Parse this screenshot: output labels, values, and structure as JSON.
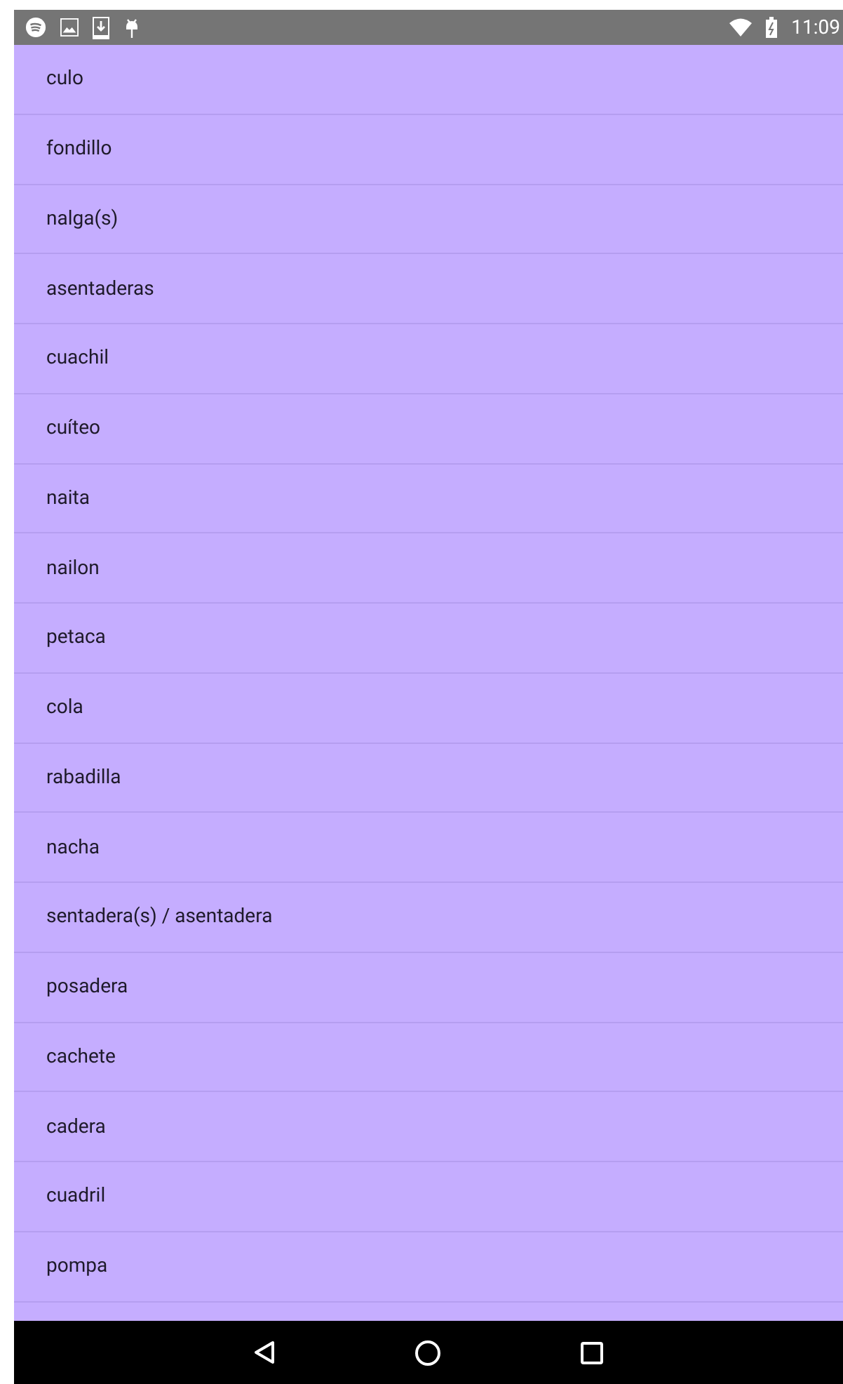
{
  "status_bar": {
    "time": "11:09"
  },
  "items": [
    "culo",
    "fondillo",
    "nalga(s)",
    "asentaderas",
    "cuachil",
    "cuíteo",
    "naita",
    "nailon",
    "petaca",
    "cola",
    "rabadilla",
    "nacha",
    "sentadera(s) / asentadera",
    "posadera",
    "cachete",
    "cadera",
    "cuadril",
    "pompa"
  ]
}
